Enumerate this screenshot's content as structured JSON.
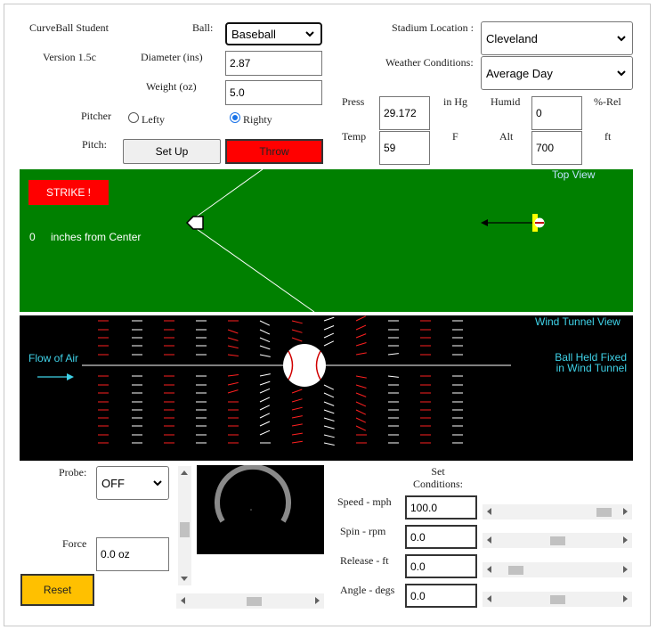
{
  "app": {
    "title": "CurveBall Student",
    "version": "Version 1.5c"
  },
  "ball": {
    "label": "Ball:",
    "selected": "Baseball"
  },
  "diameter": {
    "label": "Diameter (ins)",
    "value": "2.87"
  },
  "weight": {
    "label": "Weight (oz)",
    "value": "5.0"
  },
  "pitcher": {
    "label": "Pitcher",
    "options": [
      "Lefty",
      "Righty"
    ],
    "selected": "Righty"
  },
  "pitch": {
    "label": "Pitch:",
    "setup_label": "Set Up",
    "throw_label": "Throw"
  },
  "stadium": {
    "label": "Stadium Location :",
    "selected": "Cleveland"
  },
  "weather": {
    "label": "Weather Conditions:",
    "selected": "Average Day"
  },
  "atmos": {
    "press_label": "Press",
    "press_value": "29.172",
    "press_unit": "in Hg",
    "humid_label": "Humid",
    "humid_value": "0",
    "humid_unit": "%-Rel",
    "temp_label": "Temp",
    "temp_value": "59",
    "temp_unit": "F",
    "alt_label": "Alt",
    "alt_value": "700",
    "alt_unit": "ft"
  },
  "top_view": {
    "title": "Top View",
    "result": "STRIKE !",
    "offset_value": "0",
    "offset_label": "inches from Center"
  },
  "wind_tunnel": {
    "title": "Wind Tunnel View",
    "flow_label": "Flow of Air",
    "fixed_line1": "Ball Held Fixed",
    "fixed_line2": "in Wind Tunnel"
  },
  "probe": {
    "label": "Probe:",
    "selected": "OFF"
  },
  "force": {
    "label": "Force",
    "value": "0.0 oz"
  },
  "reset_label": "Reset",
  "set_conditions": {
    "line1": "Set",
    "line2": "Conditions:"
  },
  "conditions": [
    {
      "label": "Speed - mph",
      "value": "100.0",
      "slider_fraction": 0.95
    },
    {
      "label": "Spin - rpm",
      "value": "0.0",
      "slider_fraction": 0.5
    },
    {
      "label": "Release - ft",
      "value": "0.0",
      "slider_fraction": 0.1
    },
    {
      "label": "Angle - degs",
      "value": "0.0",
      "slider_fraction": 0.5
    }
  ],
  "colors": {
    "field_green": "#008000",
    "strike_red": "#ff0000",
    "throw_red": "#ff0000",
    "reset_yellow": "#ffc000",
    "wind_text": "#3fd2e8",
    "ball_yellow": "#ffff00"
  }
}
